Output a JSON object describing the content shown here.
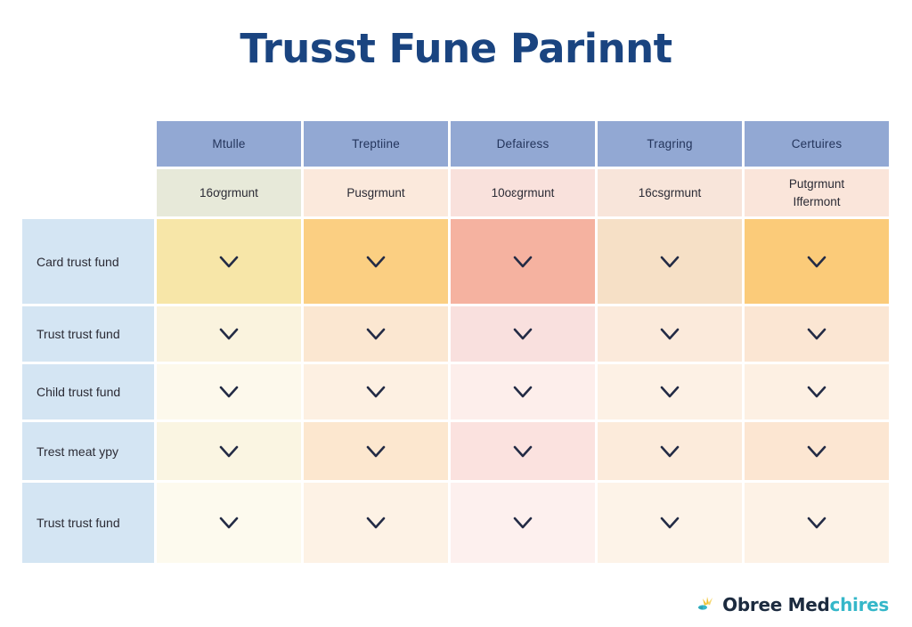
{
  "page": {
    "title": "Trusst Fune Parinnt",
    "background_color": "#ffffff",
    "title_color": "#1a4480"
  },
  "table": {
    "header_background": "#92a8d3",
    "header_text_color": "#24355c",
    "row_label_background": "#d4e5f3",
    "columns": [
      {
        "label": "Mtulle",
        "sub": "16ơgrmunt",
        "sub2": "",
        "sub_bg": "#e7e9d9"
      },
      {
        "label": "Treptiine",
        "sub": "Pusgrmunt",
        "sub2": "",
        "sub_bg": "#fbe9dc"
      },
      {
        "label": "Defairess",
        "sub": "10oɛgrmunt",
        "sub2": "",
        "sub_bg": "#f9e1dc"
      },
      {
        "label": "Tragring",
        "sub": "16csgrmunt",
        "sub2": "",
        "sub_bg": "#f8e5da"
      },
      {
        "label": "Certuires",
        "sub": "Putgrmunt",
        "sub2": "Iffermont",
        "sub_bg": "#fae5da"
      }
    ],
    "rows": [
      {
        "label": "Card trust fund",
        "cells": [
          {
            "icon": "chevron-down-icon",
            "bg": "#f7e6a8"
          },
          {
            "icon": "chevron-down-icon",
            "bg": "#fbcf82"
          },
          {
            "icon": "chevron-down-icon",
            "bg": "#f5b2a0"
          },
          {
            "icon": "chevron-down-icon",
            "bg": "#f6e0c6"
          },
          {
            "icon": "chevron-down-icon",
            "bg": "#fbcb79"
          }
        ]
      },
      {
        "label": "Trust trust fund",
        "cells": [
          {
            "icon": "chevron-down-icon",
            "bg": "#faf3de"
          },
          {
            "icon": "chevron-down-icon",
            "bg": "#fbe7d1"
          },
          {
            "icon": "chevron-down-icon",
            "bg": "#f9e0de"
          },
          {
            "icon": "chevron-down-icon",
            "bg": "#fbeadb"
          },
          {
            "icon": "chevron-down-icon",
            "bg": "#fbe6d3"
          }
        ]
      },
      {
        "label": "Child trust fund",
        "cells": [
          {
            "icon": "chevron-down-icon",
            "bg": "#fdf9ec"
          },
          {
            "icon": "chevron-down-icon",
            "bg": "#fdf0e2"
          },
          {
            "icon": "chevron-down-icon",
            "bg": "#fdeeeb"
          },
          {
            "icon": "chevron-down-icon",
            "bg": "#fdf1e5"
          },
          {
            "icon": "chevron-down-icon",
            "bg": "#fdf0e3"
          }
        ]
      },
      {
        "label": "Trest meat ypy",
        "cells": [
          {
            "icon": "chevron-down-icon",
            "bg": "#faf5e2"
          },
          {
            "icon": "chevron-down-icon",
            "bg": "#fce7cf"
          },
          {
            "icon": "chevron-down-icon",
            "bg": "#fbe2df"
          },
          {
            "icon": "chevron-down-icon",
            "bg": "#fcebdb"
          },
          {
            "icon": "chevron-down-icon",
            "bg": "#fce6d2"
          }
        ]
      },
      {
        "label": "Trust trust fund",
        "cells": [
          {
            "icon": "chevron-down-icon",
            "bg": "#fdfaee"
          },
          {
            "icon": "chevron-down-icon",
            "bg": "#fdf2e5"
          },
          {
            "icon": "chevron-down-icon",
            "bg": "#fdf0ee"
          },
          {
            "icon": "chevron-down-icon",
            "bg": "#fdf3e8"
          },
          {
            "icon": "chevron-down-icon",
            "bg": "#fdf2e6"
          }
        ]
      }
    ]
  },
  "logo": {
    "icon": "butterfly-logo-icon",
    "text_primary": "Obree Med",
    "text_accent": "chires",
    "primary_color": "#1c2b3f",
    "accent_color": "#35b7c9",
    "mark_colors": [
      "#f2c230",
      "#f5d76e",
      "#35b7c9",
      "#2f9fb0"
    ]
  }
}
